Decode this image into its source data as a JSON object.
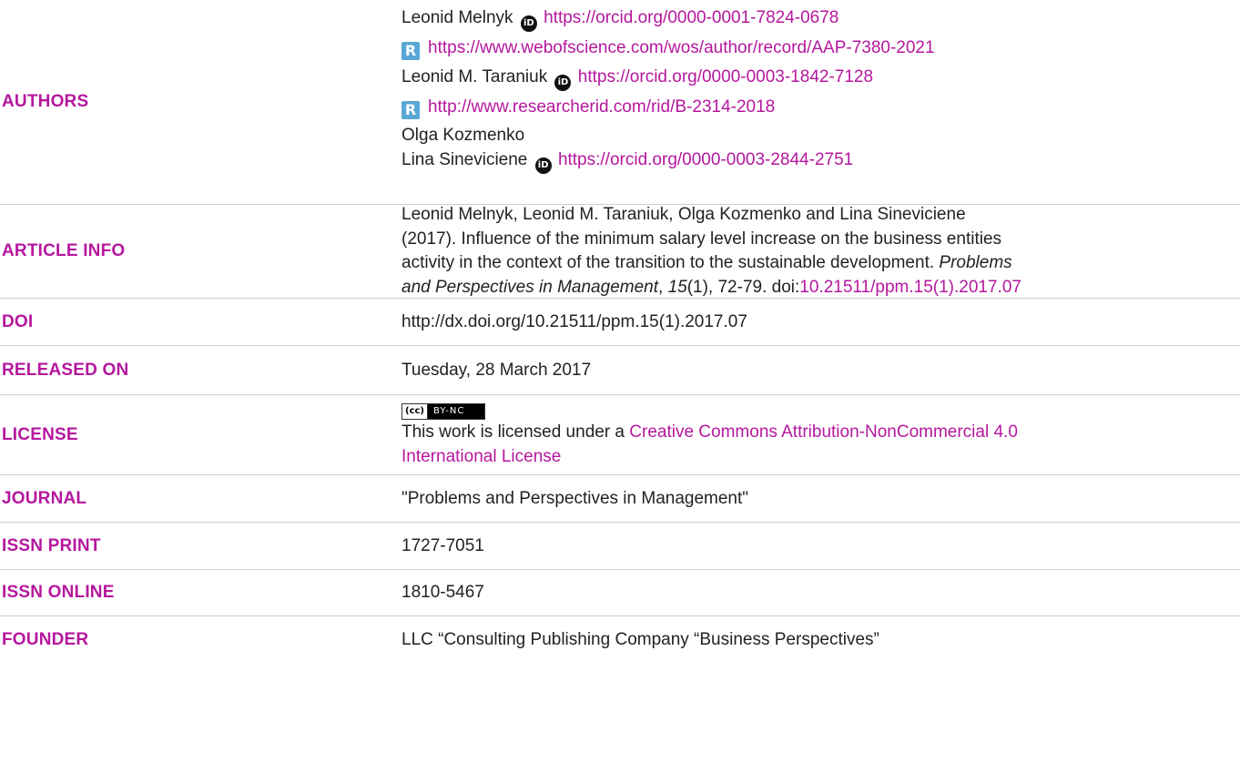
{
  "authors": {
    "label": "AUTHORS",
    "entries": [
      {
        "name": "Leonid Melnyk",
        "orcid": "https://orcid.org/0000-0001-7824-0678",
        "rid": "https://www.webofscience.com/wos/author/record/AAP-7380-2021"
      },
      {
        "name": "Leonid M. Taraniuk",
        "orcid": "https://orcid.org/0000-0003-1842-7128",
        "rid": "http://www.researcherid.com/rid/B-2314-2018"
      },
      {
        "name": "Olga Kozmenko"
      },
      {
        "name": "Lina Sineviciene",
        "orcid": "https://orcid.org/0000-0003-2844-2751"
      }
    ]
  },
  "article_info": {
    "label": "ARTICLE INFO",
    "line1": "Leonid Melnyk, Leonid M. Taraniuk, Olga Kozmenko and Lina Sineviciene",
    "line2": "(2017). Influence of the minimum salary level increase on the business entities",
    "line3a": "activity in the context of the transition to the sustainable development. ",
    "line3b": "Problems",
    "line4a": "and Perspectives in Management",
    "line4b": ", ",
    "line4c": "15",
    "line4d": "(1), 72-79. doi:",
    "doi_link": "10.21511/ppm.15(1).2017.07"
  },
  "doi": {
    "label": "DOI",
    "value": "http://dx.doi.org/10.21511/ppm.15(1).2017.07"
  },
  "released": {
    "label": "RELEASED ON",
    "value": "Tuesday, 28 March 2017"
  },
  "license": {
    "label": "LICENSE",
    "badge_cc": "(cc)",
    "badge_text": "BY-NC",
    "text": "This work is licensed under a ",
    "link_line1": "Creative Commons Attribution-NonCommercial 4.0",
    "link_line2": "International License"
  },
  "journal": {
    "label": "JOURNAL",
    "value": "\"Problems and Perspectives in Management\""
  },
  "issn_print": {
    "label": "ISSN PRINT",
    "value": "1727-7051"
  },
  "issn_online": {
    "label": "ISSN ONLINE",
    "value": "1810-5467"
  },
  "founder": {
    "label": "FOUNDER",
    "value": "LLC “Consulting Publishing Company “Business Perspectives”"
  },
  "icons": {
    "orcid": "orcid-id-icon",
    "researcherid": "researcherid-icon"
  },
  "colors": {
    "accent": "#b5179e",
    "divider": "#cfcfcf"
  }
}
